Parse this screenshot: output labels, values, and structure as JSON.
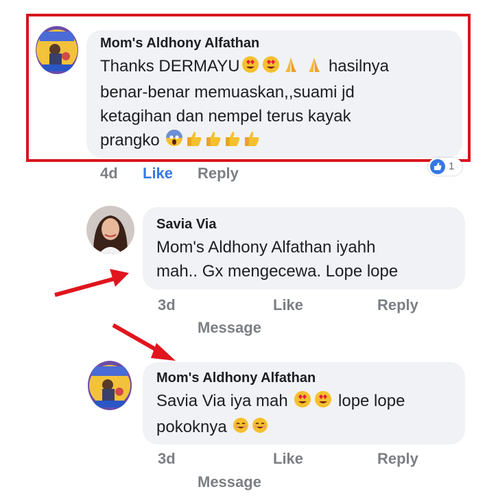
{
  "comments": [
    {
      "author": "Mom's Aldhony Alfathan",
      "text_lines": [
        "Thanks DERMAYU",
        "hasilnya",
        "benar-benar memuaskan,,suami jd",
        "ketagihan dan nempel terus kayak",
        "prangko"
      ],
      "time": "4d",
      "like": "Like",
      "reply": "Reply",
      "reaction_count": "1"
    },
    {
      "author": "Savia Via",
      "text_lines": [
        "Mom's Aldhony Alfathan iyahh",
        "mah..  Gx mengecewa. Lope lope"
      ],
      "time": "3d",
      "like": "Like",
      "reply": "Reply",
      "message": "Message"
    },
    {
      "author": "Mom's Aldhony Alfathan",
      "text_lines": [
        "Savia Via iya mah",
        "lope lope",
        "pokoknya"
      ],
      "time": "3d",
      "like": "Like",
      "reply": "Reply",
      "message": "Message"
    }
  ],
  "colors": {
    "highlight": "#d8141d",
    "arrows": "#e0151d",
    "like_active": "#3578e5",
    "bubble": "#f0f2f5"
  },
  "emoji_icons": [
    "heart-eyes-icon",
    "praying-hands-icon",
    "screaming-face-icon",
    "thumbs-up-icon",
    "smiling-face-icon"
  ]
}
